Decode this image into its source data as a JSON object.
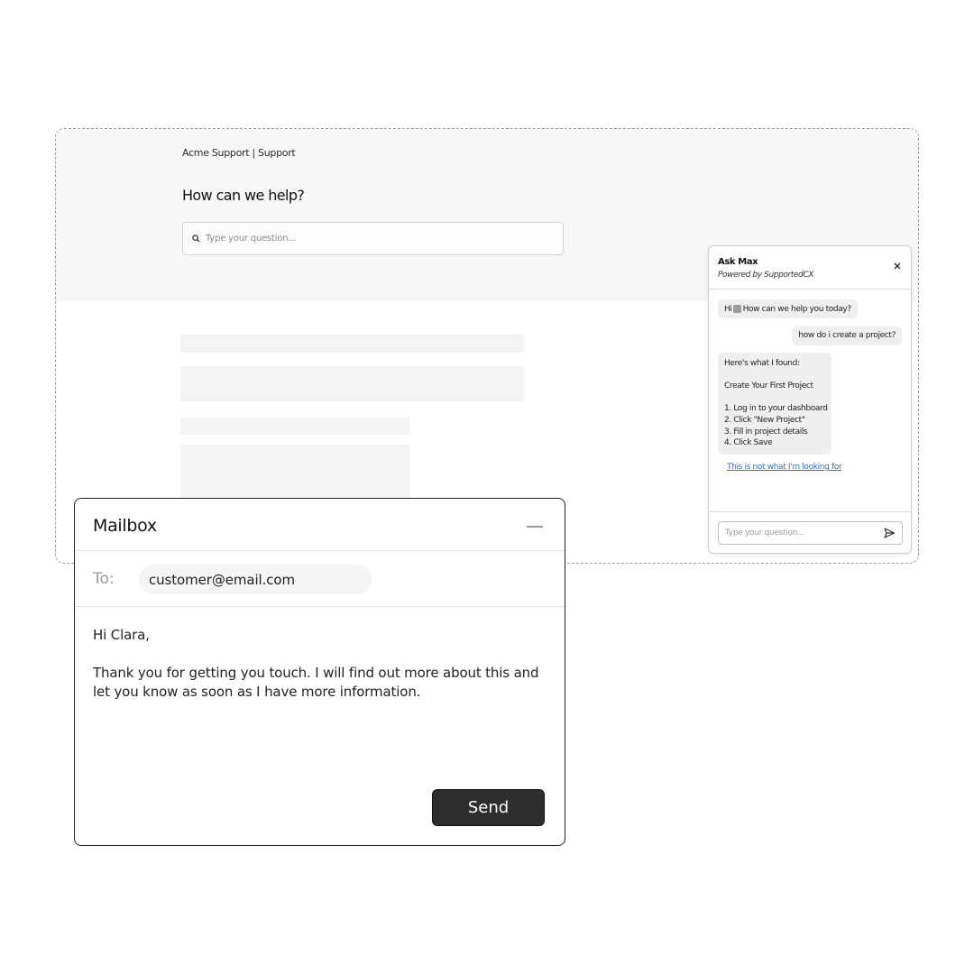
{
  "site": {
    "breadcrumb": "Acme Support | Support",
    "heading": "How can we help?",
    "search": {
      "placeholder": "Type your question...",
      "icon": "search-icon"
    }
  },
  "chat": {
    "title": "Ask Max",
    "subtitle": "Powered by SupportedCX",
    "close_icon": "close-icon",
    "messages": {
      "bot_greeting_before": "Hi",
      "bot_greeting_after": "How can we help you today?",
      "user_question": "how do i create a project?",
      "answer": {
        "intro": "Here's what I found:",
        "title": "Create Your First Project",
        "steps": [
          "1. Log in to your dashboard",
          "2. Click \"New Project\"",
          "3. Fill in project details",
          "4. Click Save"
        ]
      }
    },
    "not_found_link": "This is not what I'm looking for",
    "input_placeholder": "Type your question...",
    "send_icon": "send-icon"
  },
  "mailbox": {
    "title": "Mailbox",
    "to_label": "To:",
    "to_value": "customer@email.com",
    "greeting": "Hi Clara,",
    "body": "Thank you for getting you touch. I will find out more about this and let you know as soon as I have more information.",
    "send_label": "Send"
  },
  "colors": {
    "link": "#2b6ed9",
    "send_button": "#2e2e2e",
    "header_bg": "#f7f7f7"
  }
}
